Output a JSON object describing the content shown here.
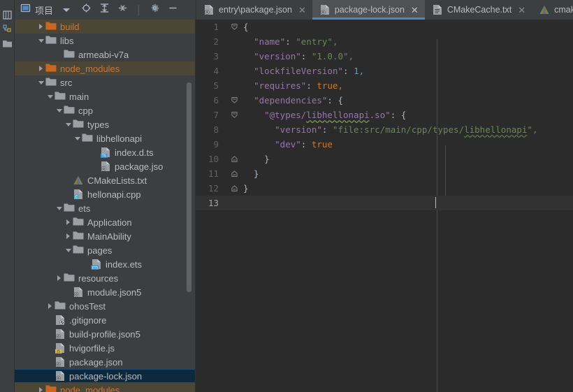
{
  "left_strip": {
    "tool_buttons": [
      {
        "name": "project-tool-window",
        "label": "项目"
      },
      {
        "name": "structure-tool-window",
        "label": "结构"
      },
      {
        "name": "folder-tool-window",
        "label": ""
      }
    ]
  },
  "project_toolbar": {
    "title": "项目",
    "title_icon": "project-window-icon",
    "dropdown_icon": "chevron-down-icon",
    "buttons": [
      {
        "name": "select-opened-file-button",
        "icon": "crosshair-icon",
        "label": ""
      },
      {
        "name": "expand-all-button",
        "icon": "expand-all-icon",
        "label": ""
      },
      {
        "name": "collapse-all-button",
        "icon": "collapse-all-icon",
        "label": ""
      },
      {
        "name": "settings-button",
        "icon": "gear-icon",
        "label": ""
      },
      {
        "name": "hide-button",
        "icon": "minus-icon",
        "label": ""
      }
    ]
  },
  "tabs": [
    {
      "label": "entry\\package.json",
      "icon": "json-file-icon",
      "active": false,
      "close": "✕"
    },
    {
      "label": "package-lock.json",
      "icon": "json-file-icon",
      "active": true,
      "close": "✕"
    },
    {
      "label": "CMakeCache.txt",
      "icon": "text-file-icon",
      "active": false,
      "close": "✕"
    },
    {
      "label": "cmake_ins",
      "icon": "cmake-file-icon",
      "active": false,
      "close": ""
    }
  ],
  "tree": [
    {
      "label": "build",
      "indent": 3,
      "arrow": "right",
      "icon": "folder-excluded-icon",
      "state": "excluded"
    },
    {
      "label": "libs",
      "indent": 3,
      "arrow": "down",
      "icon": "folder-icon",
      "state": "normal"
    },
    {
      "label": "armeabi-v7a",
      "indent": 5,
      "arrow": "none",
      "icon": "folder-icon",
      "state": "normal"
    },
    {
      "label": "node_modules",
      "indent": 3,
      "arrow": "right",
      "icon": "folder-excluded-icon",
      "state": "excluded"
    },
    {
      "label": "src",
      "indent": 3,
      "arrow": "down",
      "icon": "folder-icon",
      "state": "normal"
    },
    {
      "label": "main",
      "indent": 4,
      "arrow": "down",
      "icon": "folder-icon",
      "state": "normal"
    },
    {
      "label": "cpp",
      "indent": 5,
      "arrow": "down",
      "icon": "folder-icon",
      "state": "normal"
    },
    {
      "label": "types",
      "indent": 6,
      "arrow": "down",
      "icon": "folder-icon",
      "state": "normal"
    },
    {
      "label": "libhellonapi",
      "indent": 7,
      "arrow": "down",
      "icon": "folder-icon",
      "state": "normal"
    },
    {
      "label": "index.d.ts",
      "indent": 9,
      "arrow": "none",
      "icon": "ts-file-icon",
      "state": "normal"
    },
    {
      "label": "package.jso",
      "indent": 9,
      "arrow": "none",
      "icon": "json-file-icon",
      "state": "normal"
    },
    {
      "label": "CMakeLists.txt",
      "indent": 6,
      "arrow": "none",
      "icon": "cmake-file-icon",
      "state": "normal"
    },
    {
      "label": "hellonapi.cpp",
      "indent": 6,
      "arrow": "none",
      "icon": "cpp-file-icon",
      "state": "normal"
    },
    {
      "label": "ets",
      "indent": 5,
      "arrow": "down",
      "icon": "folder-icon",
      "state": "normal"
    },
    {
      "label": "Application",
      "indent": 6,
      "arrow": "right",
      "icon": "folder-icon",
      "state": "normal"
    },
    {
      "label": "MainAbility",
      "indent": 6,
      "arrow": "right",
      "icon": "folder-icon",
      "state": "normal"
    },
    {
      "label": "pages",
      "indent": 6,
      "arrow": "down",
      "icon": "folder-icon",
      "state": "normal"
    },
    {
      "label": "index.ets",
      "indent": 8,
      "arrow": "none",
      "icon": "ets-file-icon",
      "state": "normal"
    },
    {
      "label": "resources",
      "indent": 5,
      "arrow": "right",
      "icon": "folder-icon",
      "state": "normal"
    },
    {
      "label": "module.json5",
      "indent": 6,
      "arrow": "none",
      "icon": "json-file-icon",
      "state": "normal"
    },
    {
      "label": "ohosTest",
      "indent": 4,
      "arrow": "right",
      "icon": "folder-icon",
      "state": "normal"
    },
    {
      "label": ".gitignore",
      "indent": 4,
      "arrow": "none",
      "icon": "gitignore-file-icon",
      "state": "normal"
    },
    {
      "label": "build-profile.json5",
      "indent": 4,
      "arrow": "none",
      "icon": "json-file-icon",
      "state": "normal"
    },
    {
      "label": "hvigorfile.js",
      "indent": 4,
      "arrow": "none",
      "icon": "js-file-icon",
      "state": "normal"
    },
    {
      "label": "package.json",
      "indent": 4,
      "arrow": "none",
      "icon": "json-file-icon",
      "state": "normal"
    },
    {
      "label": "package-lock.json",
      "indent": 4,
      "arrow": "none",
      "icon": "json-file-icon",
      "state": "selected"
    },
    {
      "label": "node_modules",
      "indent": 3,
      "arrow": "right",
      "icon": "folder-excluded-icon",
      "state": "excluded"
    }
  ],
  "editor": {
    "file": "package-lock.json",
    "total_lines": 13,
    "current_line": 13,
    "lines": [
      {
        "n": 1,
        "fold": "open",
        "text": "{"
      },
      {
        "n": 2,
        "fold": "none",
        "text": "  \"name\": \"entry\","
      },
      {
        "n": 3,
        "fold": "none",
        "text": "  \"version\": \"1.0.0\","
      },
      {
        "n": 4,
        "fold": "none",
        "text": "  \"lockfileVersion\": 1,"
      },
      {
        "n": 5,
        "fold": "none",
        "text": "  \"requires\": true,"
      },
      {
        "n": 6,
        "fold": "open",
        "text": "  \"dependencies\": {"
      },
      {
        "n": 7,
        "fold": "open",
        "text": "    \"@types/libhellonapi.so\": {"
      },
      {
        "n": 8,
        "fold": "none",
        "text": "      \"version\": \"file:src/main/cpp/types/libhellonapi\","
      },
      {
        "n": 9,
        "fold": "none",
        "text": "      \"dev\": true"
      },
      {
        "n": 10,
        "fold": "close",
        "text": "    }"
      },
      {
        "n": 11,
        "fold": "close",
        "text": "  }"
      },
      {
        "n": 12,
        "fold": "close",
        "text": "}"
      },
      {
        "n": 13,
        "fold": "none",
        "text": ""
      }
    ]
  },
  "colors": {
    "editor_bg": "#2b2b2b",
    "panel_bg": "#3c3f41",
    "selection_bg": "#0d293e",
    "excluded_bg": "#4c4636",
    "accent_blue": "#4a88c7",
    "json_key": "#9876aa",
    "json_string": "#6a8759",
    "json_number": "#6897bb",
    "json_boolean": "#cc7832"
  }
}
